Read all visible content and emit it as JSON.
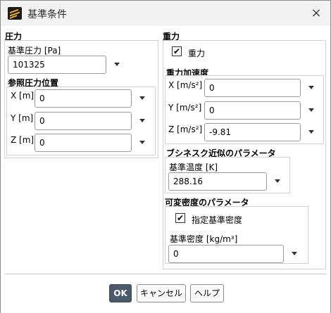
{
  "window": {
    "title": "基準条件",
    "close_glyph": "×"
  },
  "pressure": {
    "section_title": "圧力",
    "base_label": "基準圧力 [Pa]",
    "base_value": "101325",
    "ref_title": "参照圧力位置",
    "x_label": "X [m]",
    "x_value": "0",
    "y_label": "Y [m]",
    "y_value": "0",
    "z_label": "Z [m]",
    "z_value": "0"
  },
  "gravity": {
    "section_title": "重力",
    "checkbox_label": "重力",
    "checked": true,
    "accel_title": "重力加速度",
    "x_label": "X [m/s²]",
    "x_value": "0",
    "y_label": "Y [m/s²]",
    "y_value": "0",
    "z_label": "Z [m/s²]",
    "z_value": "-9.81"
  },
  "boussinesq": {
    "title": "ブシネスク近似のパラメータ",
    "temp_label": "基準温度 [K]",
    "temp_value": "288.16"
  },
  "variable_density": {
    "title": "可変密度のパラメータ",
    "checkbox_label": "指定基準密度",
    "checked": true,
    "density_label": "基準密度 [kg/m³]",
    "density_value": "0"
  },
  "buttons": {
    "ok": "OK",
    "cancel": "キャンセル",
    "help": "ヘルプ"
  },
  "colors": {
    "primary_button": "#4a5a6a",
    "checkmark": "#000000"
  }
}
